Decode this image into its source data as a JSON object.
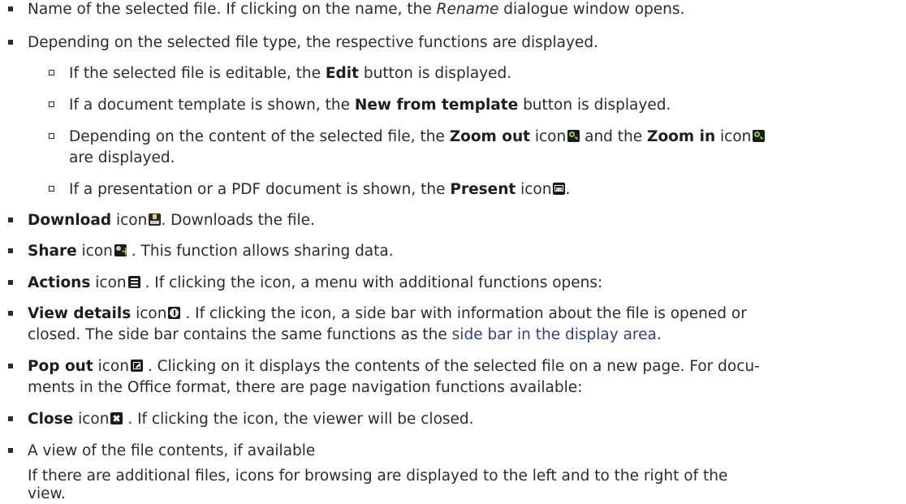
{
  "items": [
    {
      "level": 1,
      "text_before": "Name of the selected file. If clicking on the name, the ",
      "emph": "Rename",
      "text_after": " dialogue window opens."
    },
    {
      "level": 1,
      "text": "Depending on the selected file type, the respective functions are displayed."
    },
    {
      "level": 2,
      "text_before": "If the selected file is editable, the ",
      "bold": "Edit",
      "text_after": " button is displayed."
    },
    {
      "level": 2,
      "text_before": "If a document template is shown, the ",
      "bold": "New from template",
      "text_after": " button is displayed."
    },
    {
      "level": 2,
      "text_before": "Depending on the content of the selected file, the ",
      "bold1": "Zoom out",
      "mid1": " icon",
      "mid2": " and the ",
      "bold2": "Zoom in",
      "mid3": " icon",
      "line2": "are displayed."
    },
    {
      "level": 2,
      "text_before": "If a presentation or a PDF document is shown, the ",
      "bold": "Present",
      "text_mid": " icon",
      "text_after": "."
    },
    {
      "level": 1,
      "bold": "Download",
      "text_mid": " icon",
      "text_after": ". Downloads the file."
    },
    {
      "level": 1,
      "bold": "Share",
      "text_mid": " icon",
      "text_after": " . This function allows sharing data."
    },
    {
      "level": 1,
      "bold": "Actions",
      "text_mid": " icon",
      "text_after": " . If clicking the icon, a menu with additional functions opens:"
    },
    {
      "level": 1,
      "bold": "View details",
      "text_mid": " icon",
      "text_after": " . If clicking the icon, a side bar with information about the file is opened or",
      "line2_before": "closed. The side bar contains the same functions as the ",
      "link": "side bar in the display area",
      "line2_after": "."
    },
    {
      "level": 1,
      "bold": "Pop out",
      "text_mid": " icon",
      "text_after": " . Clicking on it displays the contents of the selected file on a new page. For docu-",
      "line2": "ments in the Office format, there are page navigation functions available:"
    },
    {
      "level": 1,
      "bold": "Close",
      "text_mid": " icon",
      "text_after": " . If clicking the icon, the viewer will be closed."
    },
    {
      "level": 1,
      "text": "A view of the file contents, if available"
    }
  ],
  "trailing_paragraph": {
    "line1": "If there are additional files, icons for browsing are displayed to the left and to the right of the",
    "line2": "view."
  },
  "icons": {
    "zoom_out": "zoom-out-icon",
    "zoom_in": "zoom-in-icon",
    "present": "present-icon",
    "download": "download-icon",
    "share": "share-icon",
    "actions": "actions-menu-icon",
    "view_details": "info-icon",
    "pop_out": "pop-out-icon",
    "close": "close-icon"
  },
  "colors": {
    "text": "#2b2b2b",
    "link": "#2b3f8c"
  }
}
